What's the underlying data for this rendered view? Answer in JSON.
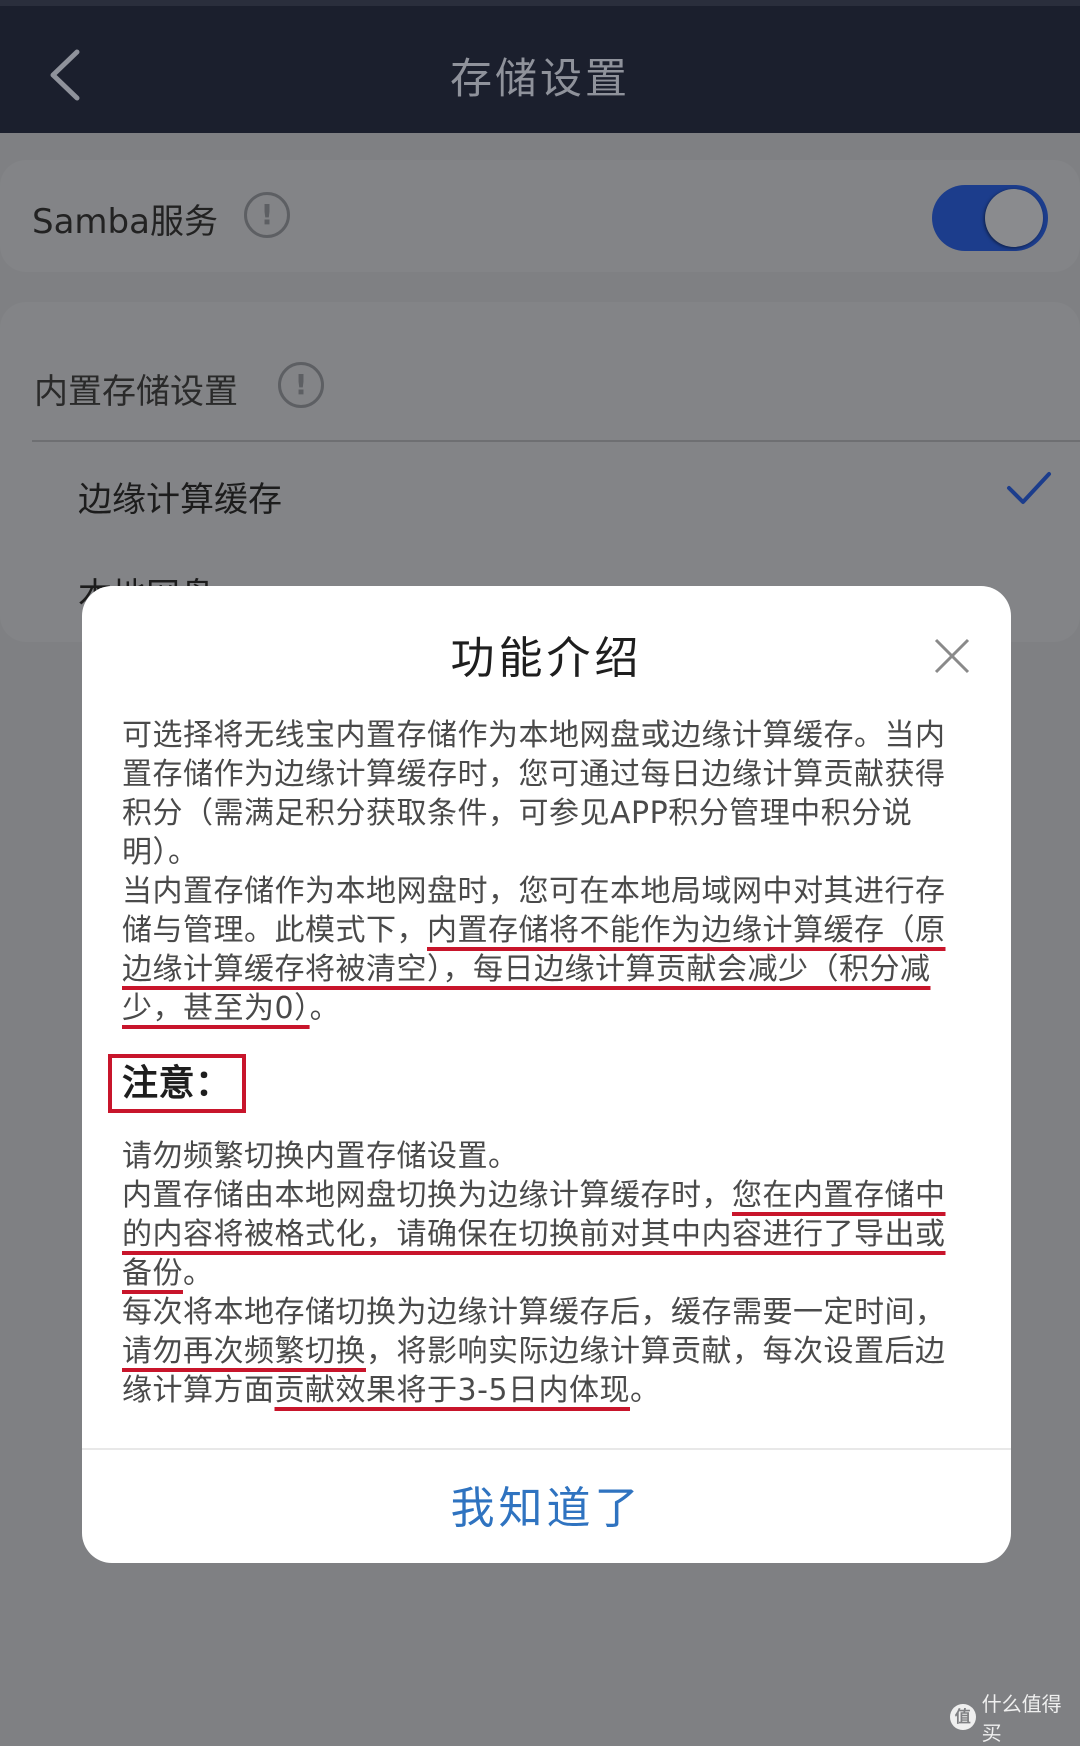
{
  "header": {
    "title": "存储设置"
  },
  "samba": {
    "label": "Samba服务",
    "enabled": true
  },
  "storage": {
    "heading": "内置存储设置",
    "options": [
      {
        "label": "边缘计算缓存",
        "selected": true
      },
      {
        "label": "本地网盘",
        "selected": false
      }
    ]
  },
  "modal": {
    "title": "功能介绍",
    "intro_1": "可选择将无线宝内置存储作为本地网盘或边缘计算缓存。当内置存储作为边缘计算缓存时，您可通过每日边缘计算贡献获得积分（需满足积分获取条件，可参见APP积分管理中积分说明）。",
    "intro_2_plain": "当内置存储作为本地网盘时，您可在本地局域网中对其进行存储与管理。此模式下，",
    "intro_2_underlined": "内置存储将不能作为边缘计算缓存（原边缘计算缓存将被清空），每日边缘计算贡献会减少（积分减少，甚至为0）",
    "intro_2_end": "。",
    "note_label": "注意：",
    "note_1": "请勿频繁切换内置存储设置。",
    "note_2_plain": "内置存储由本地网盘切换为边缘计算缓存时，",
    "note_2_underlined": "您在内置存储中的内容将被格式化，请确保在切换前对其中内容进行了导出或备份",
    "note_2_end": "。",
    "note_3_a": "每次将本地存储切换为边缘计算缓存后，缓存需要一定时间，",
    "note_3_underlined_a": "请勿再次频繁切换",
    "note_3_b": "，将影响实际边缘计算贡献，每次设置后边缘计算方面",
    "note_3_underlined_b": "贡献效果将于3-5日内体现",
    "note_3_end": "。",
    "confirm_label": "我知道了"
  },
  "watermark": {
    "logo": "值",
    "text": "什么值得买"
  },
  "colors": {
    "accent": "#2f73c0",
    "highlight": "#c8152b",
    "toggle": "#1c3d8c"
  }
}
